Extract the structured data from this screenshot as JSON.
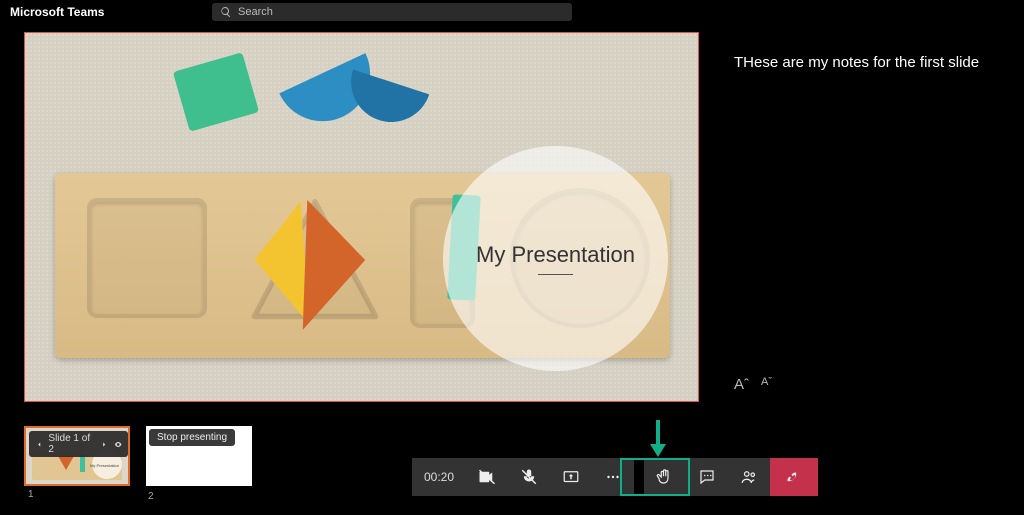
{
  "app": {
    "title": "Microsoft Teams",
    "search_placeholder": "Search"
  },
  "slide": {
    "title": "My Presentation"
  },
  "notes": {
    "text": "THese are my notes for the first slide",
    "font_bigger_label": "Aˆ",
    "font_smaller_label": "Aˇ"
  },
  "thumbs": {
    "nav_label": "Slide 1 of 2",
    "num1": "1",
    "num2": "2",
    "stop_label": "Stop presenting",
    "mini_title": "My Presentation"
  },
  "call": {
    "timer": "00:20"
  }
}
